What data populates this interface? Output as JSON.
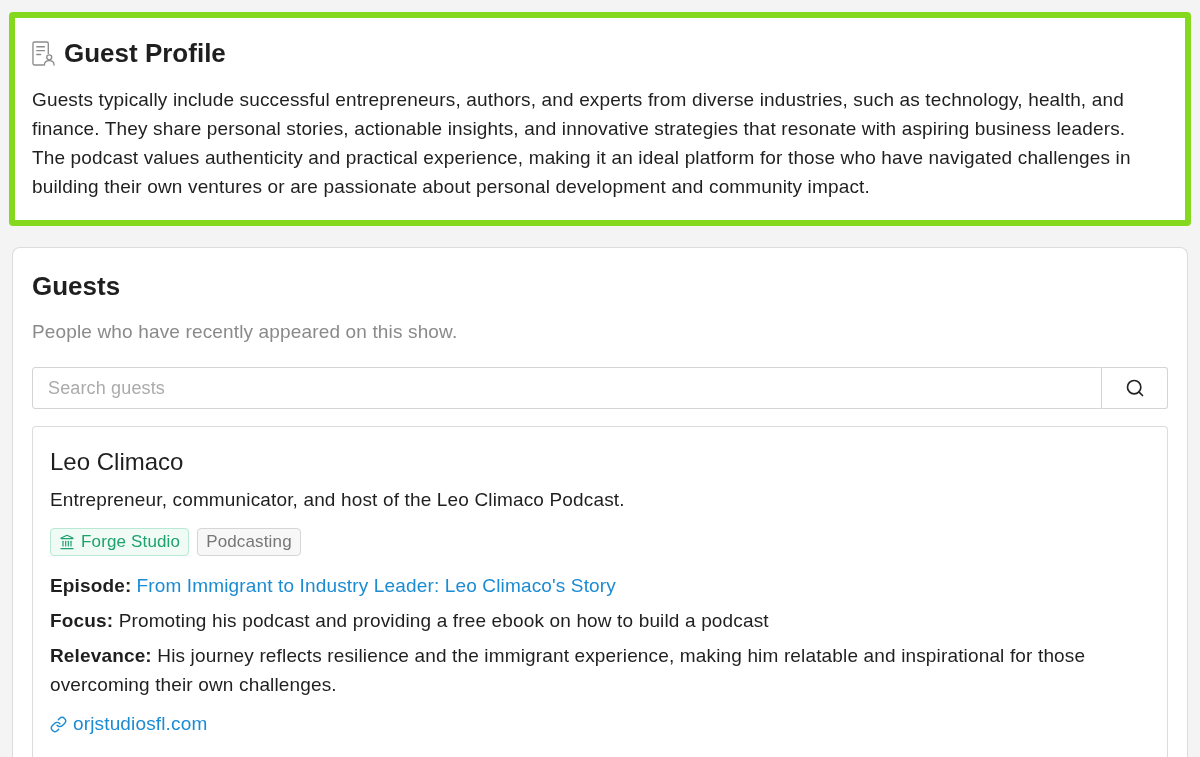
{
  "guest_profile": {
    "title": "Guest Profile",
    "highlighted": true,
    "text": "Guests typically include successful entrepreneurs, authors, and experts from diverse industries, such as technology, health, and finance. They share personal stories, actionable insights, and innovative strategies that resonate with aspiring business leaders. The podcast values authenticity and practical experience, making it an ideal platform for those who have navigated challenges in building their own ventures or are passionate about personal development and community impact."
  },
  "guests": {
    "title": "Guests",
    "subtitle": "People who have recently appeared on this show.",
    "search": {
      "placeholder": "Search guests"
    },
    "items": [
      {
        "name": "Leo Climaco",
        "description": "Entrepreneur, communicator, and host of the Leo Climaco Podcast.",
        "tags": [
          {
            "kind": "company",
            "label": "Forge Studio"
          },
          {
            "kind": "topic",
            "label": "Podcasting"
          }
        ],
        "fields": [
          {
            "kind": "link",
            "label": "Episode:",
            "value": "From Immigrant to Industry Leader: Leo Climaco's Story"
          },
          {
            "kind": "text",
            "label": "Focus:",
            "value": "Promoting his podcast and providing a free ebook on how to build a podcast"
          },
          {
            "kind": "text",
            "label": "Relevance:",
            "value": "His journey reflects resilience and the immigrant experience, making him relatable and inspirational for those overcoming their own challenges."
          }
        ],
        "website": "orjstudiosfl.com"
      }
    ]
  }
}
